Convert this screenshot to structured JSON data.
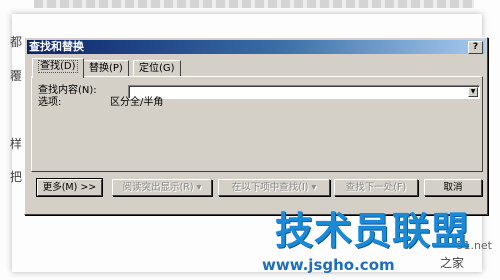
{
  "doc": {
    "left_chars": [
      "都",
      "覆",
      "样",
      "把"
    ],
    "right_frag": "51.net",
    "right_frag2": "之家"
  },
  "dialog": {
    "title": "查找和替换",
    "help_label": "?",
    "tabs": [
      {
        "label": "查找(D)",
        "active": true
      },
      {
        "label": "替换(P)",
        "active": false
      },
      {
        "label": "定位(G)",
        "active": false
      }
    ],
    "find_label": "查找内容(N):",
    "find_value": "",
    "options_label": "选项:",
    "options_value": "区分全/半角",
    "buttons": {
      "more": "更多(M) >>",
      "reading_highlight": "阅读突出显示(R) ▾",
      "find_in": "在以下项中查找(I) ▾",
      "find_next": "查找下一处(F)",
      "cancel": "取消"
    }
  },
  "watermark": {
    "brand": "技术员联盟",
    "url": "www.jsgho.com"
  }
}
